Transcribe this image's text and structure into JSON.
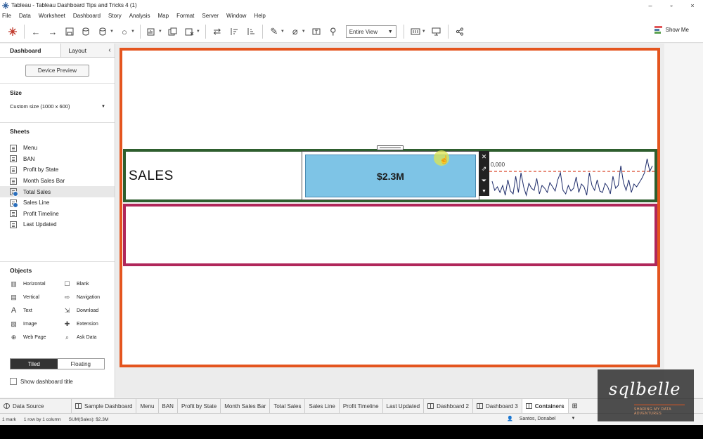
{
  "window": {
    "title": "Tableau - Tableau Dashboard Tips and Tricks 4 (1)",
    "controls": [
      "–",
      "▫",
      "×"
    ]
  },
  "menu": [
    "File",
    "Data",
    "Worksheet",
    "Dashboard",
    "Story",
    "Analysis",
    "Map",
    "Format",
    "Server",
    "Window",
    "Help"
  ],
  "toolbar": {
    "fit": "Entire View",
    "show_me": "Show Me"
  },
  "left_panel": {
    "tab_dashboard": "Dashboard",
    "tab_layout": "Layout",
    "device_preview": "Device Preview",
    "size_heading": "Size",
    "size_value": "Custom size (1000 x 600)",
    "sheets_heading": "Sheets",
    "sheets": [
      {
        "label": "Menu"
      },
      {
        "label": "BAN"
      },
      {
        "label": "Profit by State"
      },
      {
        "label": "Month Sales Bar"
      },
      {
        "label": "Total Sales"
      },
      {
        "label": "Sales Line"
      },
      {
        "label": "Profit Timeline"
      },
      {
        "label": "Last Updated"
      }
    ],
    "objects_heading": "Objects",
    "objects": {
      "horizontal": "Horizontal",
      "blank": "Blank",
      "vertical": "Vertical",
      "navigation": "Navigation",
      "text": "Text",
      "download": "Download",
      "image": "Image",
      "extension": "Extension",
      "web_page": "Web Page",
      "ask_data": "Ask Data"
    },
    "tiled": "Tiled",
    "floating": "Floating",
    "show_title": "Show dashboard title"
  },
  "dashboard": {
    "sales_label": "SALES",
    "kpi_value": "$2.3M",
    "spark_axis_label": "0,000",
    "spark_values": [
      42,
      55,
      50,
      58,
      48,
      62,
      40,
      56,
      60,
      35,
      58,
      30,
      50,
      62,
      45,
      52,
      55,
      38,
      60,
      48,
      52,
      58,
      44,
      50,
      56,
      40,
      30,
      55,
      60,
      48,
      56,
      52,
      36,
      58,
      46,
      50,
      62,
      30,
      48,
      55,
      40,
      56,
      58,
      45,
      50,
      60,
      35,
      52,
      48,
      20,
      44,
      55,
      40,
      58,
      46,
      50,
      44,
      38,
      30,
      10,
      28,
      20
    ],
    "spark_reference": 28
  },
  "sheet_tabs": [
    "Data Source",
    "Sample Dashboard",
    "Menu",
    "BAN",
    "Profit by State",
    "Month Sales Bar",
    "Total Sales",
    "Sales Line",
    "Profit Timeline",
    "Last Updated",
    "Dashboard 2",
    "Dashboard 3",
    "Containers"
  ],
  "status": {
    "marks": "1 mark",
    "rows": "1 row by 1 column",
    "sum": "SUM(Sales): $2.3M",
    "user": "Santos, Donabel"
  },
  "watermark": {
    "main": "sqlbelle",
    "sub": "SHARING MY DATA ADVENTURES"
  },
  "colors": {
    "dashboard_border": "#e4551f",
    "horizontal_container": "#2e5e2e",
    "lower_container": "#b0275a",
    "kpi_fill": "#7ec4e6",
    "spark_line": "#1f2d6b",
    "reference_line": "#d9472b"
  }
}
